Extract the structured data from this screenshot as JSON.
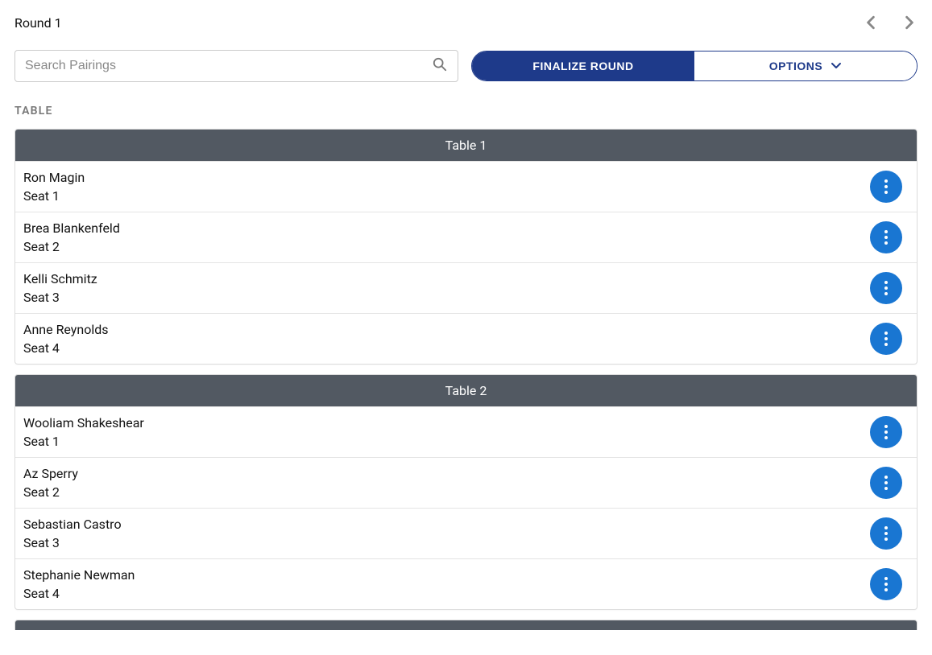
{
  "header": {
    "title": "Round 1"
  },
  "search": {
    "placeholder": "Search Pairings"
  },
  "buttons": {
    "finalize": "FINALIZE ROUND",
    "options": "OPTIONS"
  },
  "section_label": "TABLE",
  "tables": [
    {
      "title": "Table 1",
      "players": [
        {
          "name": "Ron Magin",
          "seat": "Seat 1"
        },
        {
          "name": "Brea Blankenfeld",
          "seat": "Seat 2"
        },
        {
          "name": "Kelli Schmitz",
          "seat": "Seat 3"
        },
        {
          "name": "Anne Reynolds",
          "seat": "Seat 4"
        }
      ]
    },
    {
      "title": "Table 2",
      "players": [
        {
          "name": "Wooliam Shakeshear",
          "seat": "Seat 1"
        },
        {
          "name": "Az Sperry",
          "seat": "Seat 2"
        },
        {
          "name": "Sebastian Castro",
          "seat": "Seat 3"
        },
        {
          "name": "Stephanie Newman",
          "seat": "Seat 4"
        }
      ]
    }
  ]
}
